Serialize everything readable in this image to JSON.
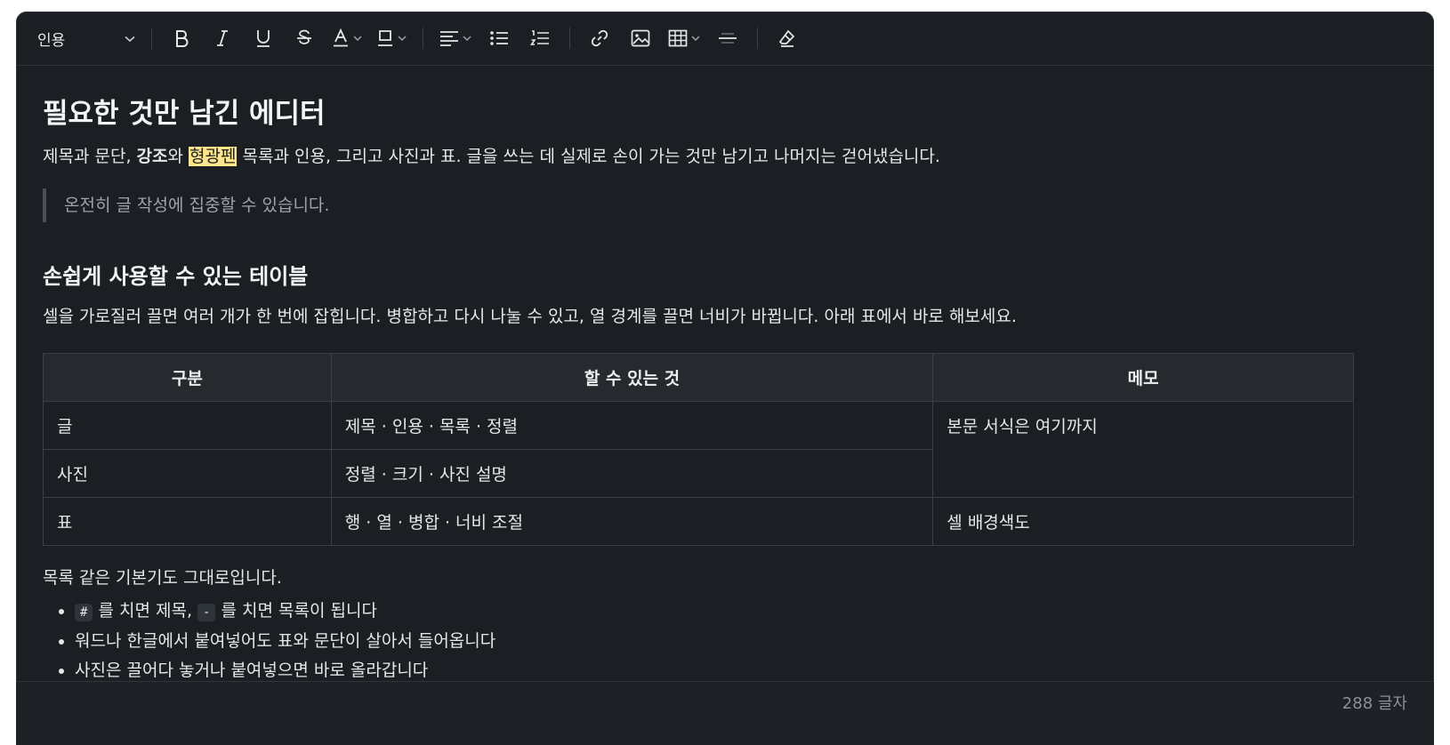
{
  "toolbar": {
    "block_type": "인용"
  },
  "content": {
    "title": "필요한 것만 남긴 에디터",
    "intro": {
      "part1": "제목과 문단, ",
      "bold": "강조",
      "part2": "와 ",
      "highlight": "형광펜",
      "part3": "  목록과 인용, 그리고 사진과 표. 글을 쓰는 데 실제로 손이 가는 것만 남기고 나머지는 걷어냈습니다."
    },
    "quote": "온전히 글 작성에 집중할 수 있습니다.",
    "section_title": "손쉽게 사용할 수 있는 테이블",
    "section_text": "셀을 가로질러 끌면 여러 개가 한 번에 잡힙니다. 병합하고 다시 나눌 수 있고, 열 경계를 끌면 너비가 바뀝니다. 아래 표에서 바로 해보세요.",
    "table": {
      "headers": [
        "구분",
        "할 수 있는 것",
        "메모"
      ],
      "rows": [
        [
          "글",
          "제목 · 인용 · 목록 · 정렬",
          "본문 서식은 여기까지"
        ],
        [
          "사진",
          "정렬 · 크기 · 사진 설명"
        ],
        [
          "표",
          "행 · 열 · 병합 · 너비 조절",
          "셀 배경색도"
        ]
      ]
    },
    "list_intro": "목록 같은 기본기도 그대로입니다.",
    "list": {
      "item1_code_a": "#",
      "item1_mid": " 를 치면 제목, ",
      "item1_code_b": "-",
      "item1_end": " 를 치면 목록이 됩니다",
      "item2": "워드나 한글에서 붙여넣어도 표와 문단이 살아서 들어옵니다",
      "item3": "사진은 끌어다 놓거나 붙여넣으면 바로 올라갑니다"
    }
  },
  "footer": {
    "char_count": "288 글자"
  },
  "colors": {
    "editor_bg": "#1b1e22",
    "highlight": "#fde68a"
  }
}
